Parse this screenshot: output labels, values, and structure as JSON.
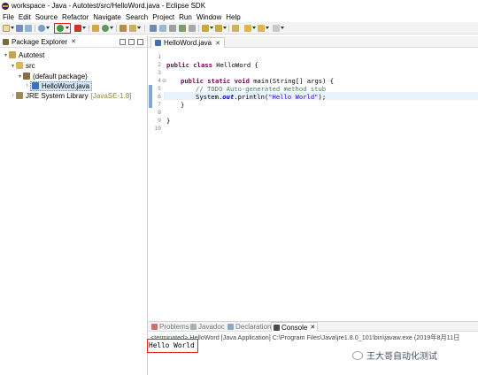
{
  "window": {
    "title": "workspace - Java - Autotest/src/HelloWord.java - Eclipse SDK"
  },
  "menubar": {
    "items": [
      "File",
      "Edit",
      "Source",
      "Refactor",
      "Navigate",
      "Search",
      "Project",
      "Run",
      "Window",
      "Help"
    ]
  },
  "package_explorer": {
    "title": "Package Explorer",
    "tree": [
      {
        "label": "Autotest",
        "icon": "java-project-icon",
        "expanded": true
      },
      {
        "label": "src",
        "icon": "source-folder-icon",
        "expanded": true
      },
      {
        "label": "(default package)",
        "icon": "package-icon",
        "expanded": true
      },
      {
        "label": "HelloWord.java",
        "icon": "java-file-icon",
        "expanded": false,
        "selected": true
      },
      {
        "label": "JRE System Library",
        "suffix": "[JavaSE-1.8]",
        "icon": "library-icon",
        "expanded": false
      }
    ]
  },
  "editor": {
    "tab_label": "HelloWord.java",
    "line_numbers": [
      "1",
      "2",
      "3",
      "4",
      "5",
      "6",
      "7",
      "8",
      "9",
      "10"
    ],
    "code": {
      "l2_kw": "public class",
      "l2_rest": " HelloWord {",
      "l4_kw": "public static void",
      "l4_rest": " main(String[] args) {",
      "l5_comment": "// TODO Auto-generated method stub",
      "l6_pre": "System.",
      "l6_field": "out",
      "l6_mid": ".println(",
      "l6_str": "\"Hello World\"",
      "l6_end": ");",
      "l7": "}",
      "l9": "}"
    }
  },
  "console": {
    "tabs": [
      "Problems",
      "Javadoc",
      "Declaration",
      "Console"
    ],
    "active_tab": "Console",
    "status": "<terminated> HelloWord [Java Application] C:\\Program Files\\Java\\jre1.8.0_101\\bin\\javaw.exe (2019年8月11日",
    "output": "Hello World"
  },
  "watermark": {
    "text": "王大哥自动化测试"
  },
  "colors": {
    "highlight_box": "#e8211f",
    "keyword": "#7f0055",
    "comment": "#3f7f5f",
    "string": "#2a00ff",
    "field": "#0000c0"
  }
}
